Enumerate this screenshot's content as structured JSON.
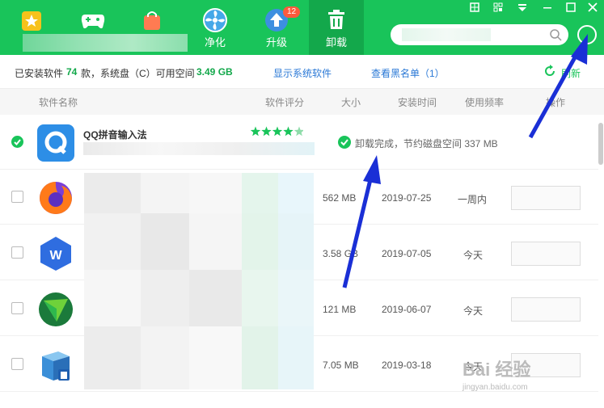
{
  "header": {
    "tabs": [
      {
        "label": "净化"
      },
      {
        "label": "升级",
        "badge": "12"
      },
      {
        "label": "卸载"
      }
    ]
  },
  "infobar": {
    "installed_prefix": "已安装软件",
    "installed_count": "74",
    "installed_suffix": "款，系统盘（C）可用空间",
    "free_space": "3.49 GB",
    "show_system": "显示系统软件",
    "blacklist": "查看黑名单（1）",
    "refresh": "刷新"
  },
  "table": {
    "headers": [
      "软件名称",
      "软件评分",
      "大小",
      "安装时间",
      "使用频率",
      "操作"
    ],
    "first_row": {
      "name": "QQ拼音输入法",
      "rating": 4.5,
      "status": "卸载完成，节约磁盘空间 337 MB"
    },
    "rows": [
      {
        "size": "562 MB",
        "date": "2019-07-25",
        "freq": "一周内",
        "icon": "firefox-icon"
      },
      {
        "size": "3.58 GB",
        "date": "2019-07-05",
        "freq": "今天",
        "icon": "wps-icon"
      },
      {
        "size": "121 MB",
        "date": "2019-06-07",
        "freq": "今天",
        "icon": "green-triangle-icon"
      },
      {
        "size": "7.05 MB",
        "date": "2019-03-18",
        "freq": "今天",
        "icon": "uninstall-box-icon"
      }
    ]
  },
  "watermark": {
    "main": "Bai 经验",
    "sub": "jingyan.baidu.com"
  },
  "colors": {
    "brand": "#19c45a",
    "active_tab": "#13a84b",
    "link": "#2a78d6",
    "arrow": "#1a2fd6"
  }
}
